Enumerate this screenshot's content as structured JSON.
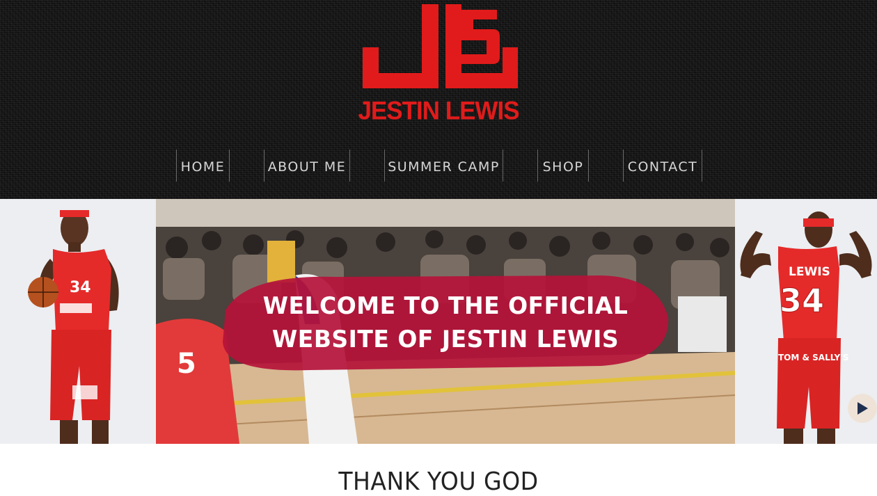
{
  "brand": {
    "logo_mark_text": "JL5",
    "name": "JESTIN LEWIS",
    "accent_color": "#e11b1b"
  },
  "nav": {
    "items": [
      {
        "label": "HOME"
      },
      {
        "label": "ABOUT ME"
      },
      {
        "label": "SUMMER CAMP"
      },
      {
        "label": "SHOP"
      },
      {
        "label": "CONTACT"
      }
    ]
  },
  "hero": {
    "welcome": "WELCOME TO THE OFFICIAL WEBSITE OF JESTIN LEWIS",
    "banner_color": "#b5123a",
    "left_player": {
      "jersey_number": "34"
    },
    "right_player": {
      "jersey_name": "LEWIS",
      "jersey_number": "34",
      "sponsor": "TOM & SALLY'S"
    },
    "video_player_number": "5",
    "play_icon": "play-icon"
  },
  "section": {
    "heading": "THANK YOU GOD"
  }
}
